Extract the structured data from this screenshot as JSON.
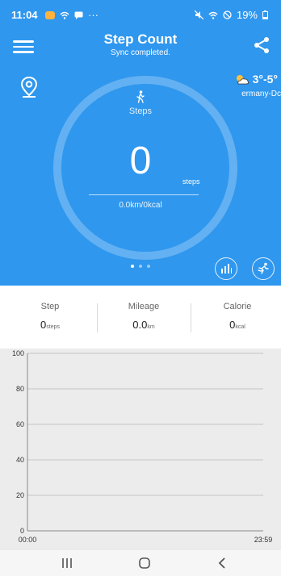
{
  "status_bar": {
    "time": "11:04",
    "extra": "···",
    "battery": "19%"
  },
  "header": {
    "title": "Step Count",
    "subtitle": "Sync completed.",
    "weather_temp": "3°-5°",
    "weather_city": "ermany-Dc",
    "steps_label": "Steps",
    "step_count": "0",
    "steps_unit": "steps",
    "distance_kcal": "0.0km/0kcal"
  },
  "summary": [
    {
      "label": "Step",
      "value": "0",
      "unit": "steps"
    },
    {
      "label": "Mileage",
      "value": "0.0",
      "unit": "km"
    },
    {
      "label": "Calorie",
      "value": "0",
      "unit": "kcal"
    }
  ],
  "chart_data": {
    "type": "line",
    "ylim": [
      0,
      100
    ],
    "yticks": [
      0,
      20,
      40,
      60,
      80,
      100
    ],
    "x_start_label": "00:00",
    "x_end_label": "23:59",
    "series": [],
    "grid": true
  },
  "colors": {
    "primary": "#2f97ee",
    "chart_bg": "#ececec"
  }
}
